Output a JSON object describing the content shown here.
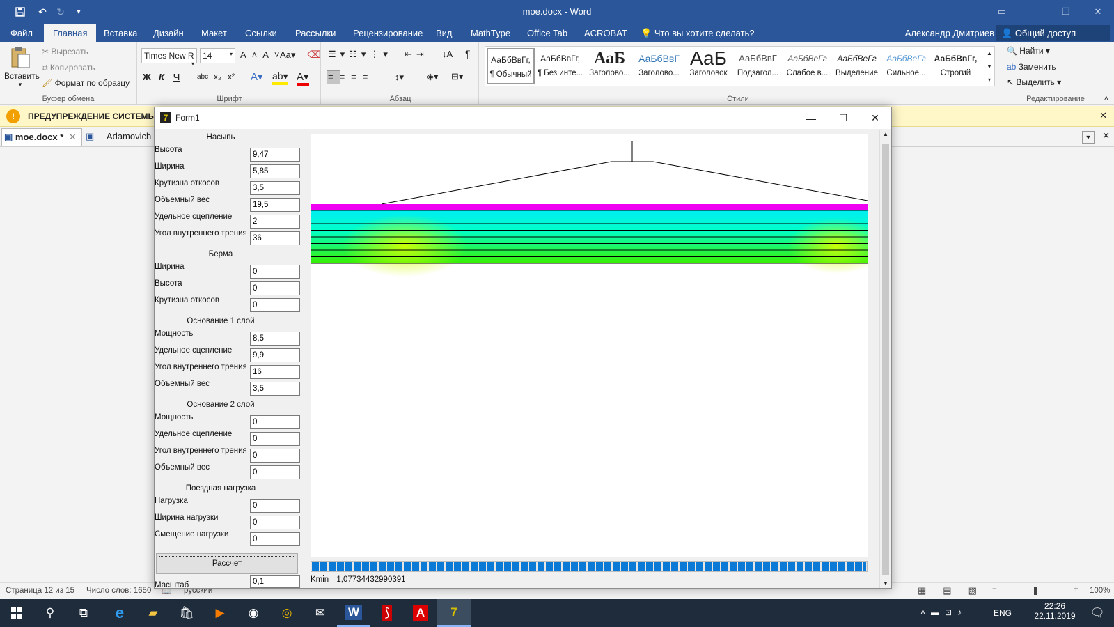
{
  "word": {
    "window_title": "moe.docx - Word",
    "tabs": [
      "Файл",
      "Главная",
      "Вставка",
      "Дизайн",
      "Макет",
      "Ссылки",
      "Рассылки",
      "Рецензирование",
      "Вид",
      "MathType",
      "Office Tab",
      "ACROBAT"
    ],
    "tell_me": "Что вы хотите сделать?",
    "user": "Александр Дмитриев",
    "share": "Общий доступ",
    "clipboard": {
      "paste": "Вставить",
      "cut": "Вырезать",
      "copy": "Копировать",
      "format_painter": "Формат по образцу",
      "label": "Буфер обмена"
    },
    "font": {
      "name": "Times New R",
      "size": "14",
      "label": "Шрифт"
    },
    "paragraph_label": "Абзац",
    "styles": {
      "items": [
        {
          "preview": "АаБбВвГг,",
          "name": "¶ Обычный"
        },
        {
          "preview": "АаБбВвГг,",
          "name": "¶ Без инте..."
        },
        {
          "preview": "АаБ",
          "name": "Заголово..."
        },
        {
          "preview": "АаБбВвГ",
          "name": "Заголово..."
        },
        {
          "preview": "АаБ",
          "name": "Заголовок"
        },
        {
          "preview": "АаБбВвГ",
          "name": "Подзагол..."
        },
        {
          "preview": "АаБбВеГг",
          "name": "Слабое в..."
        },
        {
          "preview": "АаБбВеГг",
          "name": "Выделение"
        },
        {
          "preview": "АаБбВеГг",
          "name": "Сильное..."
        },
        {
          "preview": "АаБбВвГг,",
          "name": "Строгий"
        }
      ],
      "label": "Стили"
    },
    "editing": {
      "find": "Найти",
      "replace": "Заменить",
      "select": "Выделить",
      "label": "Редактирование"
    },
    "warning": "ПРЕДУПРЕЖДЕНИЕ СИСТЕМЫ Б",
    "doc_tabs": [
      "moe.docx *",
      "Adamovich"
    ],
    "status": {
      "page": "Страница 12 из 15",
      "words": "Число слов: 1650",
      "lang": "русский",
      "zoom": "100%"
    }
  },
  "form": {
    "title": "Form1",
    "sections": {
      "embankment": "Насыпь",
      "berm": "Берма",
      "base1": "Основание 1 слой",
      "base2": "Основание 2 слой",
      "train": "Поездная нагрузка"
    },
    "embankment_fields": [
      {
        "label": "Высота",
        "value": "9,47"
      },
      {
        "label": "Ширина",
        "value": "5,85"
      },
      {
        "label": "Крутизна откосов",
        "value": "3,5"
      },
      {
        "label": "Объемный вес",
        "value": "19,5"
      },
      {
        "label": "Удельное сцепление",
        "value": "2"
      },
      {
        "label": "Угол внутреннего трения",
        "value": "36"
      }
    ],
    "berm_fields": [
      {
        "label": "Ширина",
        "value": "0"
      },
      {
        "label": "Высота",
        "value": "0"
      },
      {
        "label": "Крутизна откосов",
        "value": "0"
      }
    ],
    "base1_fields": [
      {
        "label": "Мощность",
        "value": "8,5"
      },
      {
        "label": "Удельное сцепление",
        "value": "9,9"
      },
      {
        "label": "Угол внутреннего трения",
        "value": "16"
      },
      {
        "label": "Объемный вес",
        "value": "3,5"
      }
    ],
    "base2_fields": [
      {
        "label": "Мощность",
        "value": "0"
      },
      {
        "label": "Удельное сцепление",
        "value": "0"
      },
      {
        "label": "Угол внутреннего трения",
        "value": "0"
      },
      {
        "label": "Объемный вес",
        "value": "0"
      }
    ],
    "train_fields": [
      {
        "label": "Нагрузка",
        "value": "0"
      },
      {
        "label": "Ширина нагрузки",
        "value": "0"
      },
      {
        "label": "Смещение  нагрузки",
        "value": "0"
      }
    ],
    "calc_button": "Рассчет",
    "scale_label": "Масштаб",
    "scale_value": "0,1",
    "kmin_label": "Kmin",
    "kmin_value": "1,07734432990391",
    "progress": 1.0
  },
  "taskbar": {
    "lang": "ENG",
    "time": "22:26",
    "date": "22.11.2019"
  }
}
